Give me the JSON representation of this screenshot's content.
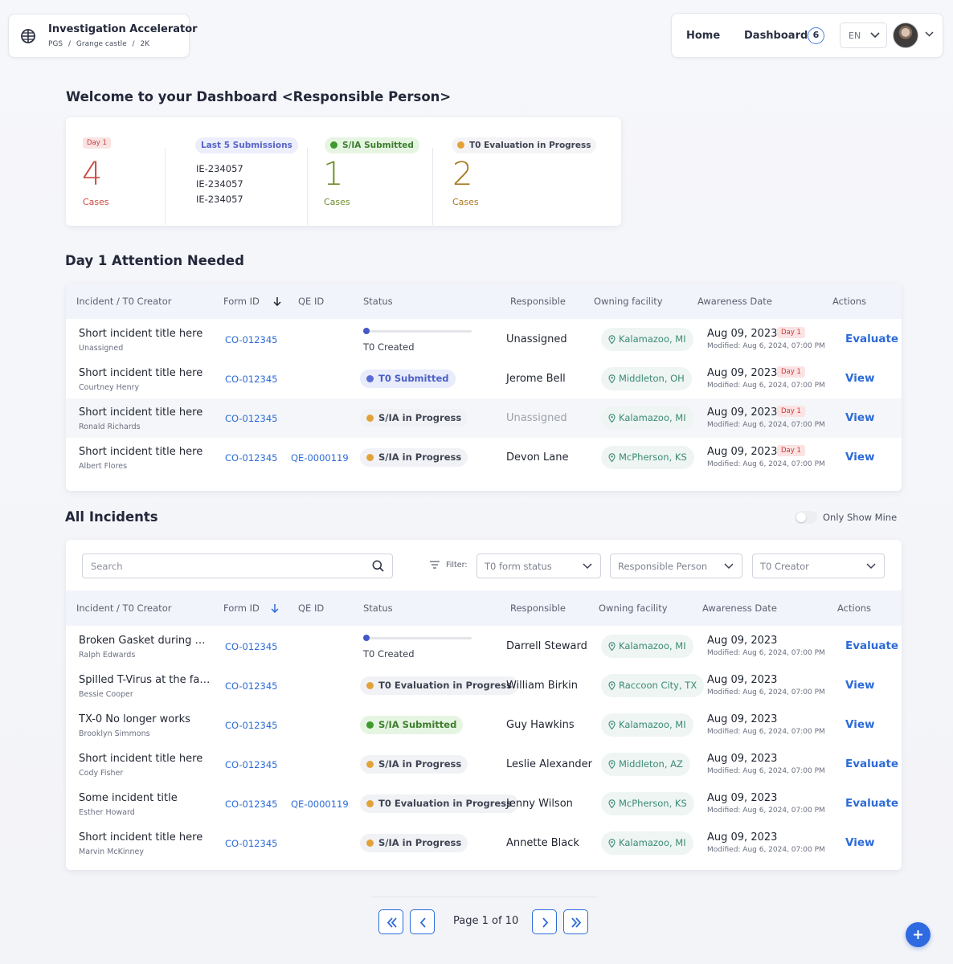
{
  "app": {
    "title": "Investigation Accelerator",
    "breadcrumb": [
      "PGS",
      "/",
      "Grange castle",
      "/",
      "2K"
    ]
  },
  "nav": {
    "home": "Home",
    "dashboard": "Dashboard",
    "dashboard_count": "6",
    "language": "EN"
  },
  "welcome": "Welcome to your Dashboard <Responsible Person>",
  "summary": {
    "day1": {
      "tag": "Day 1",
      "count": "4",
      "label": "Cases"
    },
    "last5": {
      "label": "Last 5 Submissions",
      "items": [
        "IE-234057",
        "IE-234057",
        "IE-234057"
      ]
    },
    "submitted": {
      "label": "S/IA Submitted",
      "count": "1",
      "cases": "Cases"
    },
    "evaluation": {
      "label": "T0 Evaluation in Progress",
      "count": "2",
      "cases": "Cases"
    }
  },
  "attention": {
    "heading": "Day 1 Attention Needed",
    "columns": [
      "Incident / T0 Creator",
      "Form ID",
      "QE ID",
      "Status",
      "Responsible",
      "Owning facility",
      "Awareness Date",
      "Actions"
    ],
    "rows": [
      {
        "title": "Short incident title here",
        "creator": "Unassigned",
        "form_id": "CO-012345",
        "qe_id": "",
        "status": "T0 Created",
        "responsible": "Unassigned",
        "facility": "Kalamazoo, MI",
        "date": "Aug 09, 2023",
        "day_tag": "Day 1",
        "modified": "Modified: Aug 6, 2024, 07:00 PM",
        "action": "Evaluate"
      },
      {
        "title": "Short incident title here",
        "creator": "Courtney Henry",
        "form_id": "CO-012345",
        "qe_id": "",
        "status": "T0 Submitted",
        "responsible": "Jerome Bell",
        "facility": "Middleton, OH",
        "date": "Aug 09, 2023",
        "day_tag": "Day 1",
        "modified": "Modified: Aug 6, 2024, 07:00 PM",
        "action": "View"
      },
      {
        "title": "Short incident title here",
        "creator": "Ronald Richards",
        "form_id": "CO-012345",
        "qe_id": "",
        "status": "S/IA in Progress",
        "responsible": "Unassigned",
        "facility": "Kalamazoo, MI",
        "date": "Aug 09, 2023",
        "day_tag": "Day 1",
        "modified": "Modified: Aug 6, 2024, 07:00 PM",
        "action": "View"
      },
      {
        "title": "Short incident title here",
        "creator": "Albert Flores",
        "form_id": "CO-012345",
        "qe_id": "QE-0000119",
        "status": "S/IA in Progress",
        "responsible": "Devon Lane",
        "facility": "McPherson, KS",
        "date": "Aug 09, 2023",
        "day_tag": "Day 1",
        "modified": "Modified: Aug 6, 2024, 07:00 PM",
        "action": "View"
      }
    ]
  },
  "all": {
    "heading": "All Incidents",
    "only_mine": "Only Show Mine",
    "search_placeholder": "Search",
    "filter_label": "Filter:",
    "filters": [
      "T0 form status",
      "Responsible Person",
      "T0 Creator"
    ],
    "columns": [
      "Incident / T0 Creator",
      "Form ID",
      "QE ID",
      "Status",
      "Responsible",
      "Owning facility",
      "Awareness Date",
      "Actions"
    ],
    "rows": [
      {
        "title": "Broken Gasket during a...",
        "creator": "Ralph Edwards",
        "form_id": "CO-012345",
        "qe_id": "",
        "status": "T0 Created",
        "responsible": "Darrell Steward",
        "facility": "Kalamazoo, MI",
        "date": "Aug 09, 2023",
        "modified": "Modified: Aug 6, 2024, 07:00 PM",
        "action": "Evaluate"
      },
      {
        "title": "Spilled T-Virus at the fac...",
        "creator": "Bessie Cooper",
        "form_id": "CO-012345",
        "qe_id": "",
        "status": "T0 Evaluation in Progress",
        "responsible": "William Birkin",
        "facility": "Raccoon City, TX",
        "date": "Aug 09, 2023",
        "modified": "Modified: Aug 6, 2024, 07:00 PM",
        "action": "View"
      },
      {
        "title": "TX-0 No longer works",
        "creator": "Brooklyn Simmons",
        "form_id": "CO-012345",
        "qe_id": "",
        "status": "S/IA Submitted",
        "responsible": "Guy Hawkins",
        "facility": "Kalamazoo, MI",
        "date": "Aug 09, 2023",
        "modified": "Modified: Aug 6, 2024, 07:00 PM",
        "action": "View"
      },
      {
        "title": "Short incident title here",
        "creator": "Cody Fisher",
        "form_id": "CO-012345",
        "qe_id": "",
        "status": "S/IA in Progress",
        "responsible": "Leslie Alexander",
        "facility": "Middleton, AZ",
        "date": "Aug 09, 2023",
        "modified": "Modified: Aug 6, 2024, 07:00 PM",
        "action": "Evaluate"
      },
      {
        "title": "Some incident title",
        "creator": "Esther Howard",
        "form_id": "CO-012345",
        "qe_id": "QE-0000119",
        "status": "T0 Evaluation in Progress",
        "responsible": "Jenny Wilson",
        "facility": "McPherson, KS",
        "date": "Aug 09, 2023",
        "modified": "Modified: Aug 6, 2024, 07:00 PM",
        "action": "Evaluate"
      },
      {
        "title": "Short incident title here",
        "creator": "Marvin McKinney",
        "form_id": "CO-012345",
        "qe_id": "",
        "status": "S/IA in Progress",
        "responsible": "Annette Black",
        "facility": "Kalamazoo, MI",
        "date": "Aug 09, 2023",
        "modified": "Modified: Aug 6, 2024, 07:00 PM",
        "action": "View"
      }
    ]
  },
  "pagination": {
    "text": "Page 1 of 10"
  },
  "colors": {
    "accent": "#2d6bd8",
    "day1_red": "#c63a3a",
    "submitted_green": "#3d7e2e",
    "evaluation_orange": "#e2a23a",
    "t0_blue": "#4558c6",
    "facility_teal": "#3b8a74"
  },
  "icons": [
    "globe-icon",
    "chevron-down-icon",
    "avatar",
    "search-icon",
    "filter-icon",
    "location-pin-icon",
    "sort-arrow-icon",
    "first-page-icon",
    "prev-page-icon",
    "next-page-icon",
    "last-page-icon",
    "plus-icon"
  ]
}
